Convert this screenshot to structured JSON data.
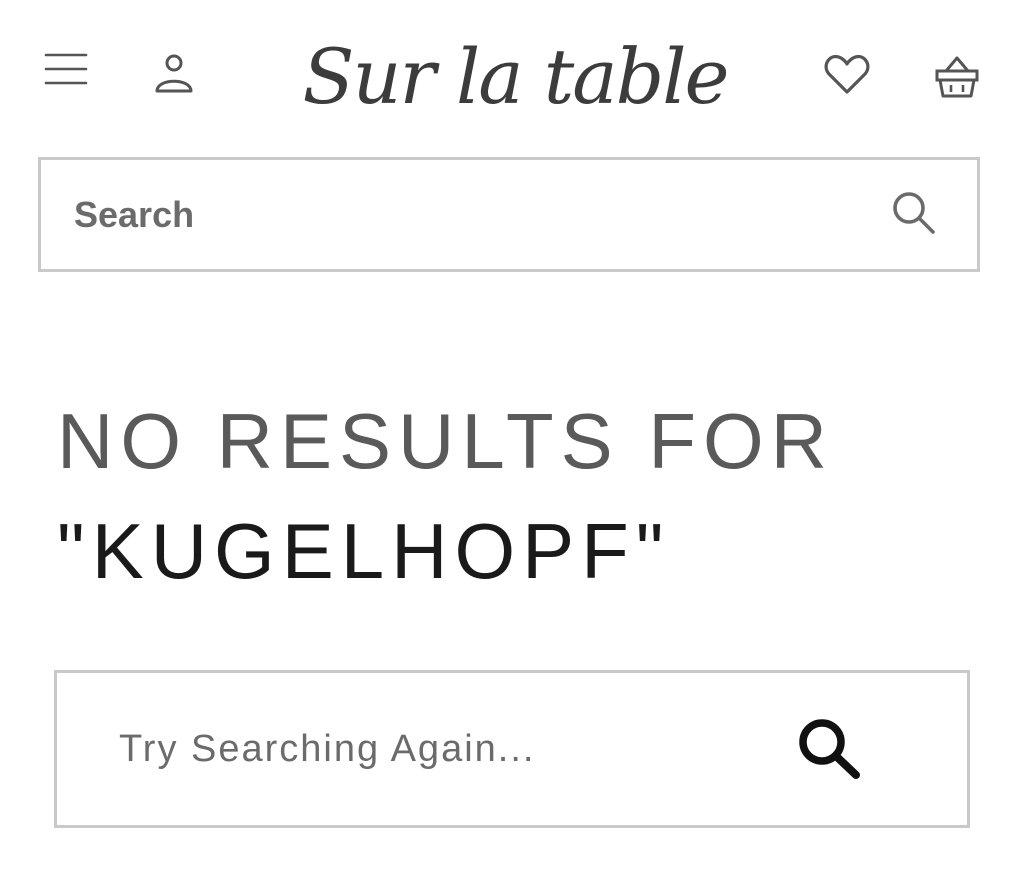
{
  "header": {
    "logo_text": "Sur la table",
    "menu_icon": "hamburger-menu-icon",
    "account_icon": "user-account-icon",
    "wishlist_icon": "heart-icon",
    "cart_icon": "shopping-basket-icon"
  },
  "search": {
    "placeholder": "Search",
    "value": "",
    "icon": "search-icon"
  },
  "results": {
    "heading": "NO RESULTS FOR",
    "query": "\"KUGELHOPF\""
  },
  "retry_search": {
    "placeholder": "Try Searching Again...",
    "value": "",
    "icon": "search-icon"
  },
  "colors": {
    "text": "#4a4a4a",
    "border": "#c9c9c9",
    "query_text": "#1a1a1a",
    "background": "#ffffff"
  }
}
